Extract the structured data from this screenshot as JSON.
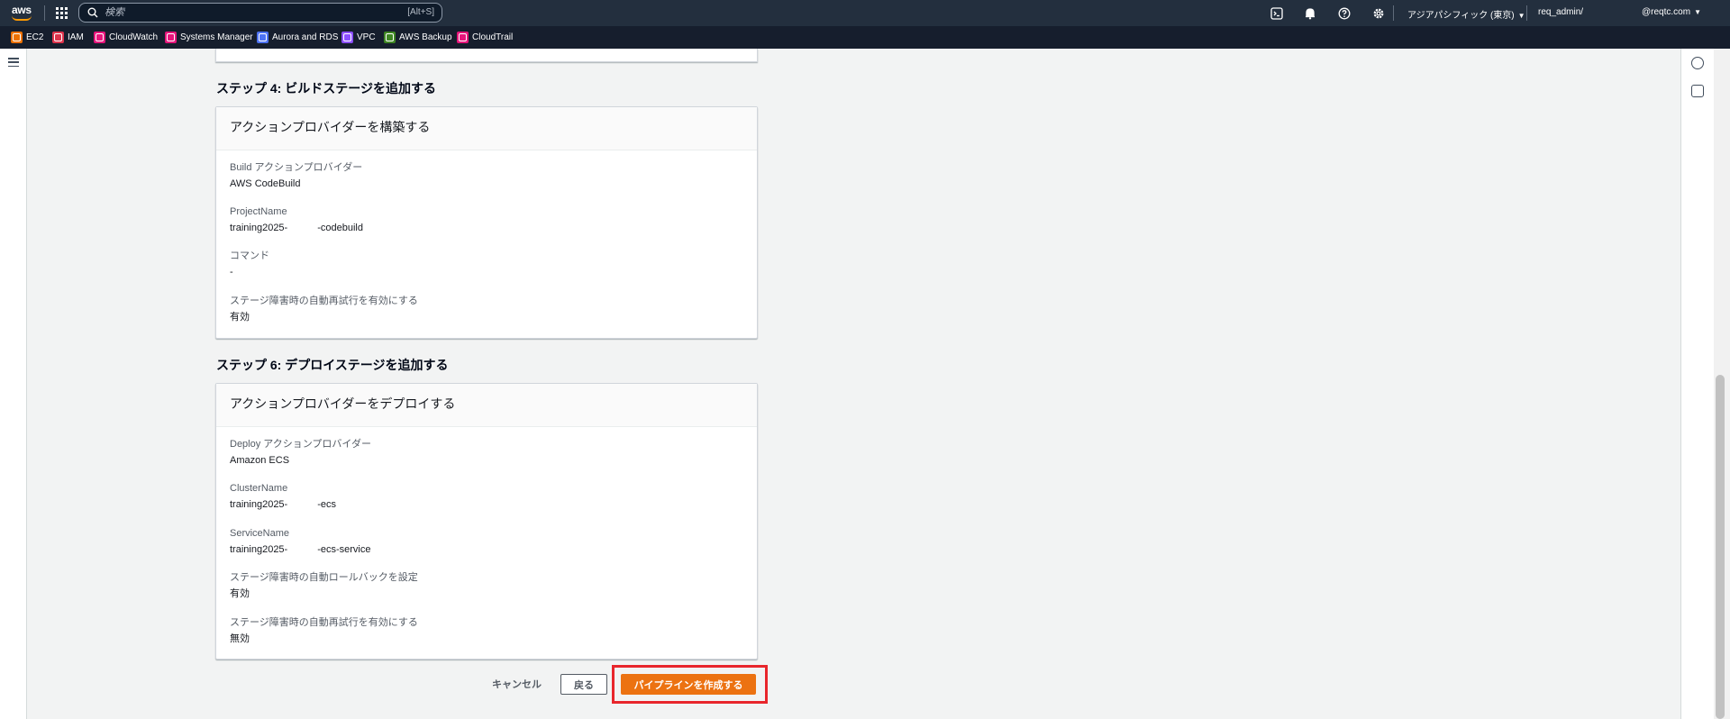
{
  "topnav": {
    "logo": "aws",
    "search_placeholder": "検索",
    "search_shortcut": "[Alt+S]",
    "region": "アジアパシフィック (東京)",
    "account": "req_admin/",
    "user": "@reqtc.com",
    "icons": [
      "cloudshell-icon",
      "bell-icon",
      "help-icon",
      "gear-icon"
    ]
  },
  "favorites": [
    {
      "label": "EC2",
      "color": "#ed7100"
    },
    {
      "label": "IAM",
      "color": "#dd344c"
    },
    {
      "label": "CloudWatch",
      "color": "#e7157b"
    },
    {
      "label": "Systems Manager",
      "color": "#e7157b"
    },
    {
      "label": "Aurora and RDS",
      "color": "#4d72f3"
    },
    {
      "label": "VPC",
      "color": "#8c4fff"
    },
    {
      "label": "AWS Backup",
      "color": "#3f8624"
    },
    {
      "label": "CloudTrail",
      "color": "#e7157b"
    }
  ],
  "step4": {
    "heading": "ステップ 4: ビルドステージを追加する",
    "panel_title": "アクションプロバイダーを構築する",
    "fields": [
      {
        "key": "Build アクションプロバイダー",
        "value": "AWS CodeBuild"
      },
      {
        "key": "ProjectName",
        "value": "training2025-　　　-codebuild"
      },
      {
        "key": "コマンド",
        "value": "-"
      },
      {
        "key": "ステージ障害時の自動再試行を有効にする",
        "value": "有効"
      }
    ]
  },
  "step6": {
    "heading": "ステップ 6: デプロイステージを追加する",
    "panel_title": "アクションプロバイダーをデプロイする",
    "fields": [
      {
        "key": "Deploy アクションプロバイダー",
        "value": "Amazon ECS"
      },
      {
        "key": "ClusterName",
        "value": "training2025-　　　-ecs"
      },
      {
        "key": "ServiceName",
        "value": "training2025-　　　-ecs-service"
      },
      {
        "key": "ステージ障害時の自動ロールバックを設定",
        "value": "有効"
      },
      {
        "key": "ステージ障害時の自動再試行を有効にする",
        "value": "無効"
      }
    ]
  },
  "footer": {
    "cancel": "キャンセル",
    "back": "戻る",
    "create": "パイプラインを作成する"
  }
}
